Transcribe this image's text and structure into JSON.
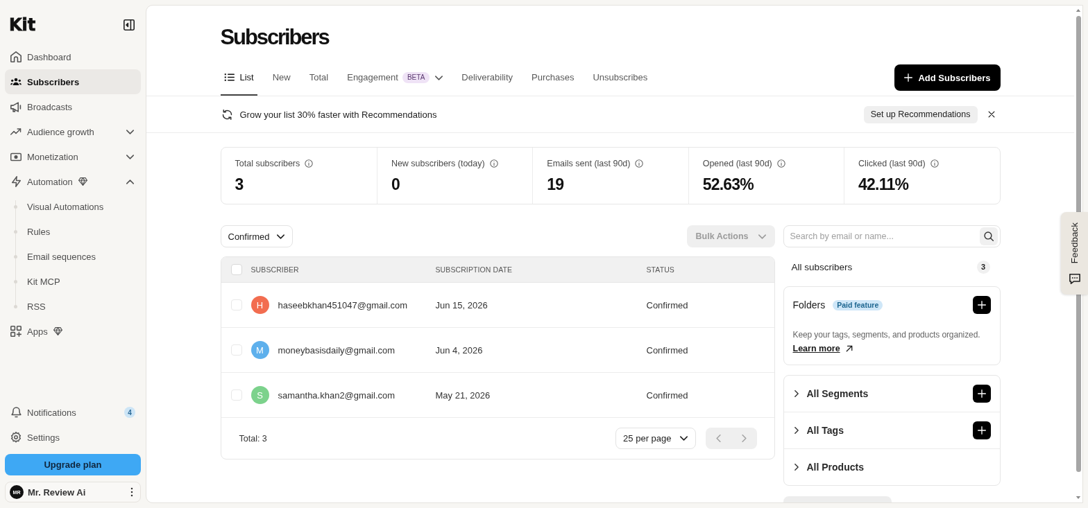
{
  "sidebar": {
    "logo": "Kit",
    "nav": [
      {
        "label": "Dashboard",
        "kind": "link",
        "selected": false,
        "paid": false
      },
      {
        "label": "Subscribers",
        "kind": "link",
        "selected": true,
        "paid": false
      },
      {
        "label": "Broadcasts",
        "kind": "link",
        "selected": false,
        "paid": false
      },
      {
        "label": "Audience growth",
        "kind": "group",
        "selected": false,
        "paid": false,
        "expanded": false
      },
      {
        "label": "Monetization",
        "kind": "group",
        "selected": false,
        "paid": false,
        "expanded": false
      },
      {
        "label": "Automation",
        "kind": "group",
        "selected": false,
        "paid": true,
        "expanded": true,
        "children": [
          {
            "label": "Visual Automations",
            "selected": false
          },
          {
            "label": "Rules",
            "selected": false
          },
          {
            "label": "Email sequences",
            "selected": false
          },
          {
            "label": "Kit MCP",
            "selected": false
          },
          {
            "label": "RSS",
            "selected": false
          }
        ]
      },
      {
        "label": "Apps",
        "kind": "link",
        "selected": false,
        "paid": true
      }
    ],
    "footer_nav": [
      {
        "label": "Notifications",
        "count": "4"
      },
      {
        "label": "Settings"
      }
    ],
    "upgrade_button": "Upgrade plan",
    "account": {
      "initials": "MR",
      "name": "Mr. Review Ai"
    }
  },
  "page_title": "Subscribers",
  "tabs": [
    {
      "label": "List",
      "kind": "icon",
      "selected": true
    },
    {
      "label": "New",
      "kind": "plain",
      "selected": false
    },
    {
      "label": "Total",
      "kind": "plain",
      "selected": false
    },
    {
      "label": "Engagement",
      "kind": "dropdown",
      "badge": "BETA",
      "selected": false
    },
    {
      "label": "Deliverability",
      "kind": "plain",
      "selected": false
    },
    {
      "label": "Purchases",
      "kind": "plain",
      "selected": false
    },
    {
      "label": "Unsubscribes",
      "kind": "plain",
      "selected": false
    }
  ],
  "add_button": "Add Subscribers",
  "banner": {
    "text": "Grow your list 30% faster with Recommendations",
    "action": "Set up Recommendations"
  },
  "stats": [
    {
      "label": "Total subscribers",
      "value": "3"
    },
    {
      "label": "New subscribers (today)",
      "value": "0"
    },
    {
      "label": "Emails sent (last 90d)",
      "value": "19"
    },
    {
      "label": "Opened (last 90d)",
      "value": "52.63%"
    },
    {
      "label": "Clicked (last 90d)",
      "value": "42.11%"
    }
  ],
  "filter": {
    "value": "Confirmed"
  },
  "bulk_actions": {
    "label": "Bulk Actions",
    "disabled": true
  },
  "table": {
    "columns": [
      "SUBSCRIBER",
      "SUBSCRIPTION DATE",
      "STATUS"
    ],
    "select_all": {
      "checked": false
    },
    "rows": [
      {
        "checked": false,
        "initial": "H",
        "color": "#f26d50",
        "email": "haseebkhan451047@gmail.com",
        "date": "Jun 15, 2026",
        "status": "Confirmed"
      },
      {
        "checked": false,
        "initial": "M",
        "color": "#5eb0ec",
        "email": "moneybasisdaily@gmail.com",
        "date": "Jun 4, 2026",
        "status": "Confirmed"
      },
      {
        "checked": false,
        "initial": "S",
        "color": "#7cd28c",
        "email": "samantha.khan2@gmail.com",
        "date": "May 21, 2026",
        "status": "Confirmed"
      }
    ],
    "total": "Total: 3",
    "per_page": "25 per page",
    "pagination": [
      {
        "kind": "previous",
        "disabled": true
      },
      {
        "kind": "next",
        "disabled": true
      }
    ]
  },
  "search": {
    "placeholder": "Search by email or name..."
  },
  "all_subscribers": {
    "label": "All subscribers",
    "count": "3"
  },
  "folders": {
    "title": "Folders",
    "badge": "Paid feature",
    "description": "Keep your tags, segments, and products organized.",
    "link": "Learn more"
  },
  "lists": [
    {
      "label": "All Segments",
      "expanded": false,
      "addable": true
    },
    {
      "label": "All Tags",
      "expanded": false,
      "addable": true
    },
    {
      "label": "All Products",
      "expanded": false,
      "addable": false
    }
  ],
  "feedback": {
    "label": "Feedback"
  }
}
